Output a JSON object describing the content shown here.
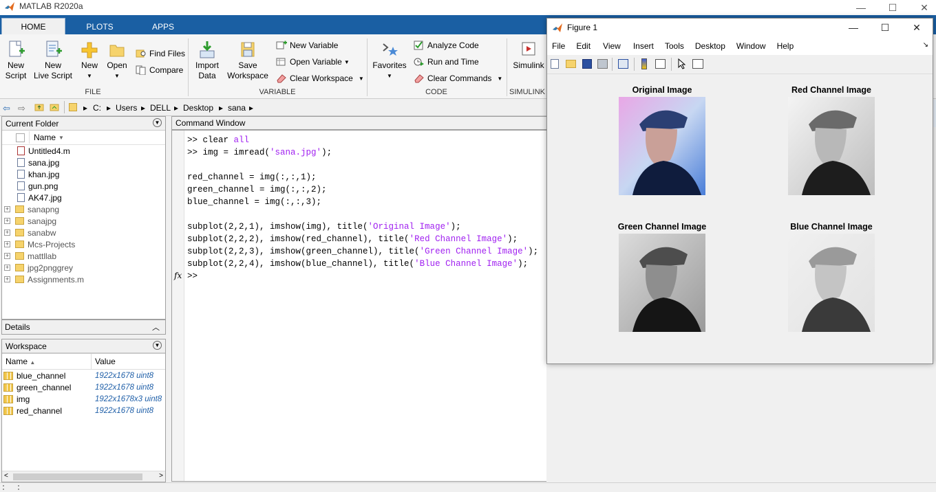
{
  "app": {
    "title": "MATLAB R2020a"
  },
  "window_controls": {
    "minimize": "—",
    "maximize": "☐",
    "close": "✕"
  },
  "ribbon": {
    "tabs": [
      "HOME",
      "PLOTS",
      "APPS"
    ],
    "file": {
      "new_script": [
        "New",
        "Script"
      ],
      "new_live_script": [
        "New",
        "Live Script"
      ],
      "new": "New",
      "open": "Open",
      "find_files": "Find Files",
      "compare": "Compare",
      "group": "FILE"
    },
    "variable": {
      "import_data": [
        "Import",
        "Data"
      ],
      "save_workspace": [
        "Save",
        "Workspace"
      ],
      "new_variable": "New Variable",
      "open_variable": "Open Variable",
      "clear_workspace": "Clear Workspace",
      "group": "VARIABLE"
    },
    "code": {
      "favorites": "Favorites",
      "analyze_code": "Analyze Code",
      "run_and_time": "Run and Time",
      "clear_commands": "Clear Commands",
      "group": "CODE"
    },
    "simulink": {
      "label": "Simulink",
      "group": "SIMULINK"
    }
  },
  "address": {
    "path": [
      "C:",
      "Users",
      "DELL",
      "Desktop",
      "sana"
    ]
  },
  "current_folder": {
    "title": "Current Folder",
    "column": "Name",
    "files": [
      "Untitled4.m",
      "sana.jpg",
      "khan.jpg",
      "gun.png",
      "AK47.jpg"
    ],
    "folders": [
      "sanapng",
      "sanajpg",
      "sanabw",
      "Mcs-Projects",
      "mattllab",
      "jpg2pnggrey",
      "Assignments.m"
    ]
  },
  "details": {
    "title": "Details"
  },
  "workspace": {
    "title": "Workspace",
    "columns": [
      "Name",
      "Value"
    ],
    "rows": [
      {
        "name": "blue_channel",
        "value": "1922x1678 uint8"
      },
      {
        "name": "green_channel",
        "value": "1922x1678 uint8"
      },
      {
        "name": "img",
        "value": "1922x1678x3 uint8"
      },
      {
        "name": "red_channel",
        "value": "1922x1678 uint8"
      }
    ]
  },
  "command_window": {
    "title": "Command Window",
    "fx": "fx",
    "prompt": ">>"
  },
  "figure": {
    "title": "Figure 1",
    "menu": [
      "File",
      "Edit",
      "View",
      "Insert",
      "Tools",
      "Desktop",
      "Window",
      "Help"
    ],
    "subplots": [
      "Original Image",
      "Red Channel Image",
      "Green Channel Image",
      "Blue Channel Image"
    ]
  },
  "colors": {
    "ribbon_blue": "#1a5fa3",
    "string_purple": "#a020f0",
    "numeric_blue": "#1f5fa8"
  }
}
